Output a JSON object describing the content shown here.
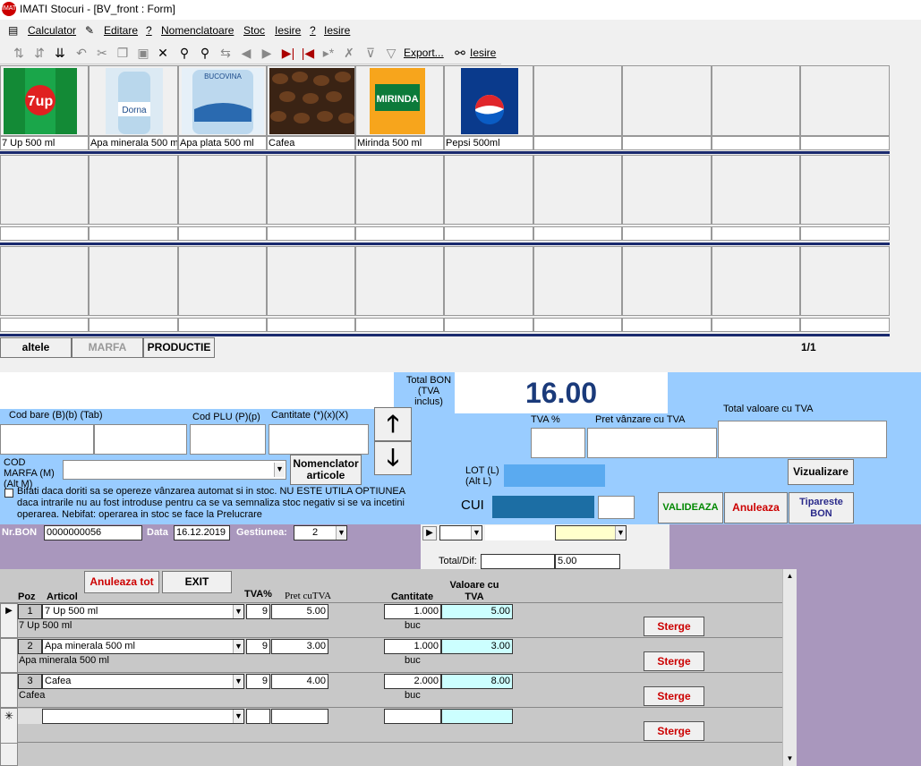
{
  "window": {
    "title": "IMATI Stocuri - [BV_front : Form]",
    "icon_text": "IMATI"
  },
  "menu": [
    "Calculator",
    "Editare",
    "?",
    "Nomenclatoare",
    "Stoc",
    "Iesire",
    "?",
    "Iesire"
  ],
  "toolbar": {
    "export_label": "Export...",
    "exit_label": "Iesire"
  },
  "products": [
    {
      "label": "7 Up 500 ml",
      "img": "7up"
    },
    {
      "label": "Apa minerala 500 ml",
      "img": "dorna"
    },
    {
      "label": "Apa plata 500 ml",
      "img": "bucovina"
    },
    {
      "label": "Cafea",
      "img": "coffee"
    },
    {
      "label": "Mirinda 500 ml",
      "img": "mirinda"
    },
    {
      "label": "Pepsi 500ml",
      "img": "pepsi"
    }
  ],
  "categories": {
    "altele": "altele",
    "marfa": "MARFA",
    "productie": "PRODUCTIE",
    "page": "1/1"
  },
  "total": {
    "label": "Total BON (TVA inclus)",
    "value": "16.00"
  },
  "entry": {
    "cod_bare_label": "Cod bare (B)(b) (Tab)",
    "cod_plu_label": "Cod PLU (P)(p)",
    "cantitate_label": "Cantitate (*)(x)(X)",
    "tva_label": "TVA %",
    "pret_label": "Pret vânzare cu TVA",
    "total_val_label": "Total valoare cu TVA",
    "cod_marfa_label": "COD MARFA (M) (Alt M)",
    "nomenclator_label": "Nomenclator articole",
    "lot_label": "LOT (L) (Alt L)",
    "cui_label": "CUI",
    "checkbox_text": "Bifati daca doriti sa se opereze vânzarea automat si in stoc. NU ESTE UTILA OPTIUNEA daca intrarile nu au fost introduse pentru ca se va semnaliza stoc negativ si se va incetini operarea. Nebifat: operarea in stoc se face la Prelucrare",
    "vizualizare": "Vizualizare",
    "valideaza": "VALIDEAZA",
    "anuleaza": "Anuleaza",
    "tipareste": "Tipareste BON"
  },
  "header": {
    "nr_bon_label": "Nr.BON",
    "nr_bon": "0000000056",
    "data_label": "Data",
    "data": "16.12.2019",
    "gestiunea_label": "Gestiunea:",
    "gestiunea": "2",
    "total_dif_label": "Total/Dif:",
    "total_dif": "5.00"
  },
  "table": {
    "anuleaza_tot": "Anuleaza tot",
    "exit": "EXIT",
    "col_poz": "Poz",
    "col_articol": "Articol",
    "col_tva": "TVA%",
    "col_pret": "Pret cuTVA",
    "col_cantitate": "Cantitate",
    "col_valoare": "Valoare cu TVA",
    "sterge": "Sterge",
    "rows": [
      {
        "poz": "1",
        "articol": "7 Up 500 ml",
        "tva": "9",
        "pret": "5.00",
        "cantitate": "1.000",
        "valoare": "5.00",
        "desc": "7 Up 500 ml",
        "um": "buc"
      },
      {
        "poz": "2",
        "articol": "Apa minerala 500 ml",
        "tva": "9",
        "pret": "3.00",
        "cantitate": "1.000",
        "valoare": "3.00",
        "desc": "Apa minerala 500 ml",
        "um": "buc"
      },
      {
        "poz": "3",
        "articol": "Cafea",
        "tva": "9",
        "pret": "4.00",
        "cantitate": "2.000",
        "valoare": "8.00",
        "desc": "Cafea",
        "um": "buc"
      }
    ]
  },
  "colors": {
    "blue_panel": "#99ccff",
    "purple": "#a997bd",
    "navy": "#1a2a6e",
    "valideaza": "#008800",
    "anuleaza": "#cc0000",
    "tipareste": "#2a2a8a",
    "cyan_cell": "#ccffff",
    "yellow_cell": "#ffffcc",
    "lot_cui": "#1c6ea4"
  }
}
